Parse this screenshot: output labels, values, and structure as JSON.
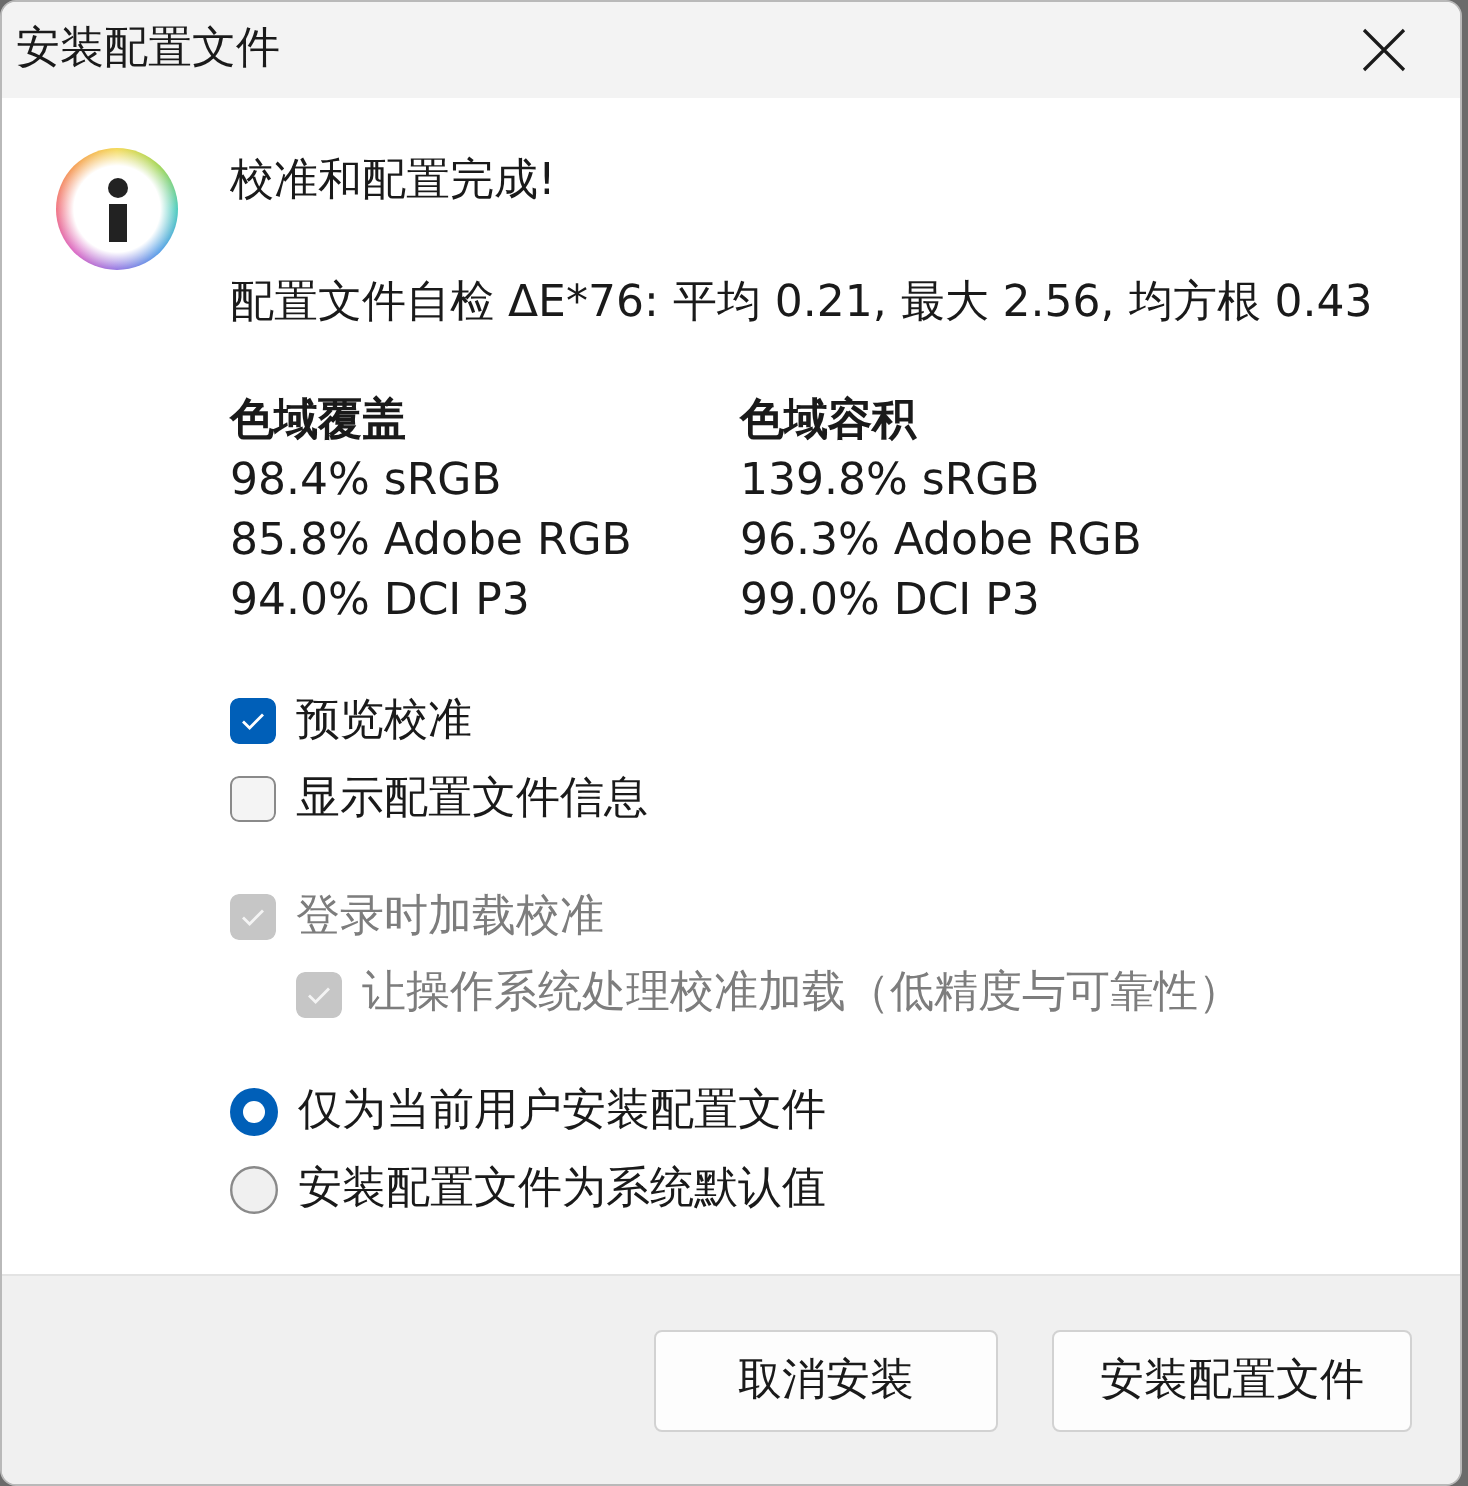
{
  "window": {
    "title": "安装配置文件"
  },
  "message": {
    "heading": "校准和配置完成!",
    "self_check": "配置文件自检 ΔE*76: 平均 0.21, 最大 2.56, 均方根 0.43"
  },
  "gamut": [
    {
      "heading": "色域覆盖",
      "values": [
        "98.4% sRGB",
        "85.8% Adobe RGB",
        "94.0% DCI P3"
      ]
    },
    {
      "heading": "色域容积",
      "values": [
        "139.8% sRGB",
        "96.3% Adobe RGB",
        "99.0% DCI P3"
      ]
    }
  ],
  "option_groups": [
    [
      {
        "kind": "checkbox",
        "label": "预览校准",
        "checked": true,
        "disabled": false
      },
      {
        "kind": "checkbox",
        "label": "显示配置文件信息",
        "checked": false,
        "disabled": false
      }
    ],
    [
      {
        "kind": "checkbox",
        "label": "登录时加载校准",
        "checked": true,
        "disabled": true,
        "children": [
          {
            "kind": "checkbox",
            "label": "让操作系统处理校准加载（低精度与可靠性）",
            "checked": true,
            "disabled": true
          }
        ]
      }
    ],
    [
      {
        "kind": "radio",
        "label": "仅为当前用户安装配置文件",
        "selected": true,
        "disabled": false
      },
      {
        "kind": "radio",
        "label": "安装配置文件为系统默认值",
        "selected": false,
        "disabled": false
      }
    ]
  ],
  "buttons": [
    {
      "label": "取消安装"
    },
    {
      "label": "安装配置文件"
    }
  ]
}
